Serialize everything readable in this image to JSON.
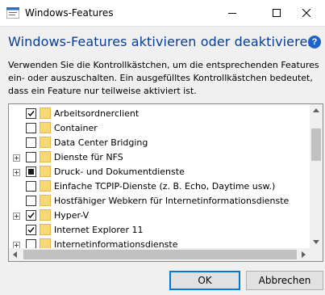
{
  "window": {
    "title": "Windows-Features"
  },
  "heading": "Windows-Features aktivieren oder deaktivieren",
  "description": "Verwenden Sie die Kontrollkästchen, um die entsprechenden Features ein- oder auszuschalten. Ein ausgefülltes Kontrollkästchen bedeutet, dass ein Feature nur teilweise aktiviert ist.",
  "features": [
    {
      "label": "Arbeitsordnerclient",
      "state": "checked",
      "expandable": false
    },
    {
      "label": "Container",
      "state": "unchecked",
      "expandable": false
    },
    {
      "label": "Data Center Bridging",
      "state": "unchecked",
      "expandable": false
    },
    {
      "label": "Dienste für NFS",
      "state": "unchecked",
      "expandable": true
    },
    {
      "label": "Druck- und Dokumentdienste",
      "state": "partial",
      "expandable": true
    },
    {
      "label": "Einfache TCPIP-Dienste (z. B. Echo, Daytime usw.)",
      "state": "unchecked",
      "expandable": false
    },
    {
      "label": "Hostfähiger Webkern für Internetinformationsdienste",
      "state": "unchecked",
      "expandable": false
    },
    {
      "label": "Hyper-V",
      "state": "checked",
      "expandable": true
    },
    {
      "label": "Internet Explorer 11",
      "state": "checked",
      "expandable": false
    },
    {
      "label": "Internetinformationsdienste",
      "state": "unchecked",
      "expandable": true
    }
  ],
  "buttons": {
    "ok": "OK",
    "cancel": "Abbrechen"
  },
  "help_glyph": "?",
  "colors": {
    "heading": "#0b3d91",
    "accent": "#0078d7",
    "folder": "#f8d775"
  }
}
